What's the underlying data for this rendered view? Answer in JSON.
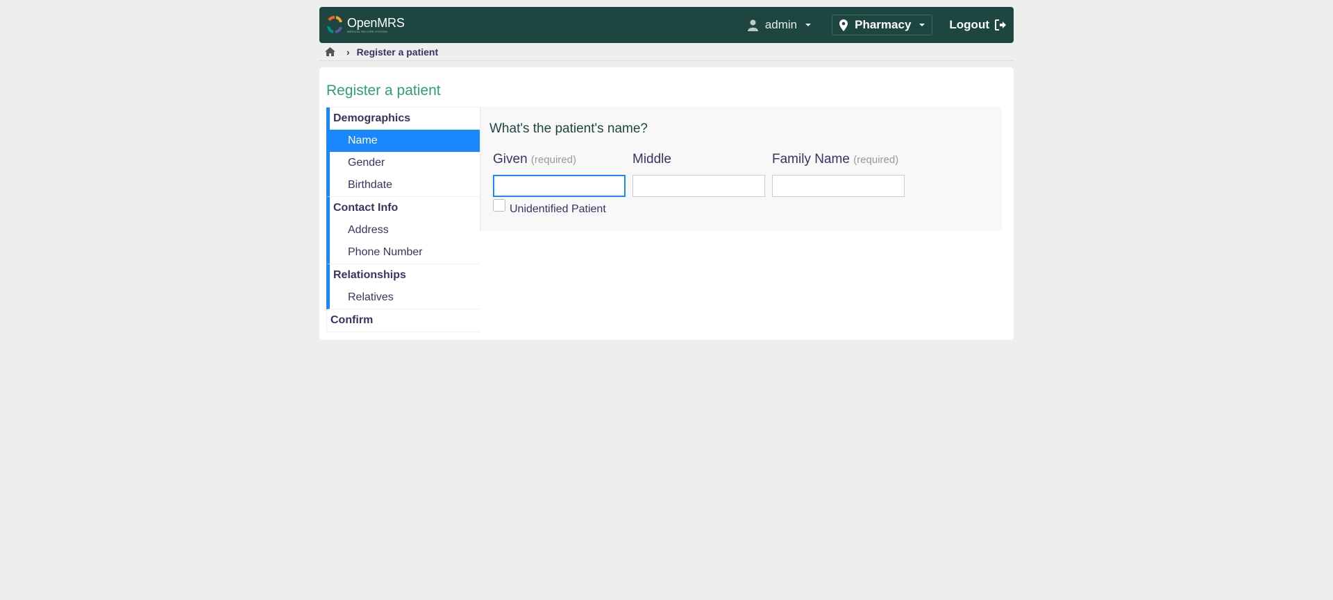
{
  "header": {
    "logo_text": "OpenMRS",
    "logo_subtext": "MEDICAL RECORD SYSTEM",
    "user": "admin",
    "location": "Pharmacy",
    "logout": "Logout"
  },
  "breadcrumb": {
    "current": "Register a patient"
  },
  "page": {
    "title": "Register a patient"
  },
  "nav": {
    "sections": [
      {
        "title": "Demographics",
        "items": [
          "Name",
          "Gender",
          "Birthdate"
        ]
      },
      {
        "title": "Contact Info",
        "items": [
          "Address",
          "Phone Number"
        ]
      },
      {
        "title": "Relationships",
        "items": [
          "Relatives"
        ]
      },
      {
        "title": "Confirm",
        "items": []
      }
    ],
    "active_item": "Name"
  },
  "form": {
    "question": "What's the patient's name?",
    "given_label": "Given",
    "given_required": "(required)",
    "given_value": "",
    "middle_label": "Middle",
    "middle_value": "",
    "family_label": "Family Name",
    "family_required": "(required)",
    "family_value": "",
    "unidentified_label": "Unidentified Patient"
  },
  "colors": {
    "header_bg": "#1e4640",
    "accent_blue": "#1b87ff",
    "title_green": "#2e9d75",
    "text_navy": "#363463"
  },
  "icons": {
    "home": "home-icon",
    "user": "user-icon",
    "location": "map-marker-icon",
    "logout": "sign-out-icon"
  }
}
